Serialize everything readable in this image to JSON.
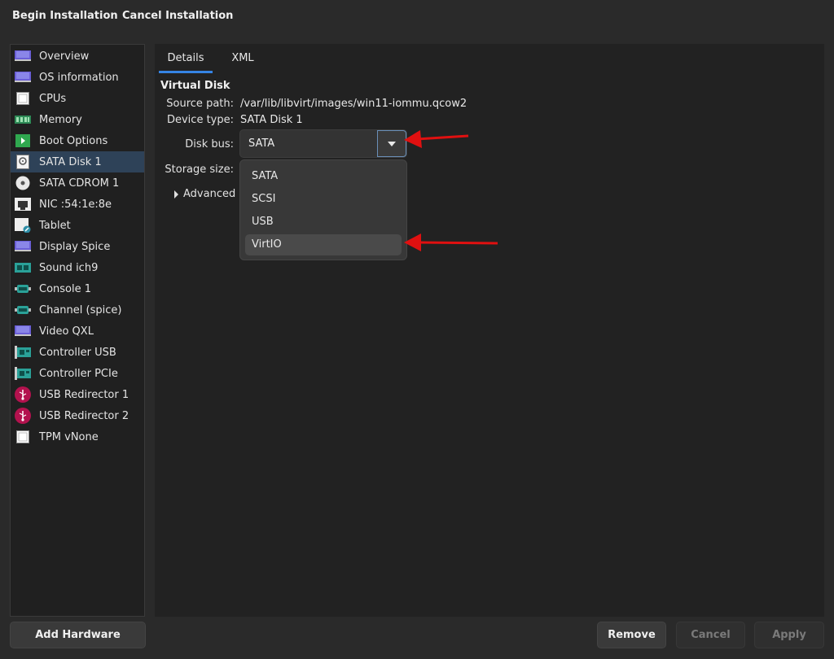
{
  "header": {
    "begin_label": "Begin Installation",
    "cancel_label": "Cancel Installation"
  },
  "sidebar": {
    "items": [
      {
        "label": "Overview",
        "icon": "monitor-icon"
      },
      {
        "label": "OS information",
        "icon": "monitor-icon"
      },
      {
        "label": "CPUs",
        "icon": "cpu-icon"
      },
      {
        "label": "Memory",
        "icon": "memory-icon"
      },
      {
        "label": "Boot Options",
        "icon": "boot-icon"
      },
      {
        "label": "SATA Disk 1",
        "icon": "disk-icon"
      },
      {
        "label": "SATA CDROM 1",
        "icon": "cdrom-icon"
      },
      {
        "label": "NIC :54:1e:8e",
        "icon": "network-icon"
      },
      {
        "label": "Tablet",
        "icon": "tablet-icon"
      },
      {
        "label": "Display Spice",
        "icon": "display-icon"
      },
      {
        "label": "Sound ich9",
        "icon": "sound-icon"
      },
      {
        "label": "Console 1",
        "icon": "serial-icon"
      },
      {
        "label": "Channel (spice)",
        "icon": "serial-icon"
      },
      {
        "label": "Video QXL",
        "icon": "display-icon"
      },
      {
        "label": "Controller USB",
        "icon": "controller-icon"
      },
      {
        "label": "Controller PCIe",
        "icon": "controller-icon"
      },
      {
        "label": "USB Redirector 1",
        "icon": "usb-icon"
      },
      {
        "label": "USB Redirector 2",
        "icon": "usb-icon"
      },
      {
        "label": "TPM vNone",
        "icon": "cpu-icon"
      }
    ],
    "selected": "SATA Disk 1"
  },
  "tabs": {
    "details": "Details",
    "xml": "XML"
  },
  "details": {
    "section_title": "Virtual Disk",
    "source_path_label": "Source path:",
    "source_path_value": "/var/lib/libvirt/images/win11-iommu.qcow2",
    "device_type_label": "Device type:",
    "device_type_value": "SATA Disk 1",
    "disk_bus_label": "Disk bus:",
    "disk_bus_value": "SATA",
    "storage_size_label": "Storage size:",
    "advanced_label": "Advanced o"
  },
  "dropdown": {
    "options": [
      "SATA",
      "SCSI",
      "USB",
      "VirtIO"
    ],
    "hovered": "VirtIO"
  },
  "footer": {
    "add_hardware": "Add Hardware",
    "remove": "Remove",
    "cancel": "Cancel",
    "apply": "Apply"
  },
  "colors": {
    "accent": "#3584e4",
    "selection": "#2e4258",
    "annotation_arrow": "#e01010"
  }
}
